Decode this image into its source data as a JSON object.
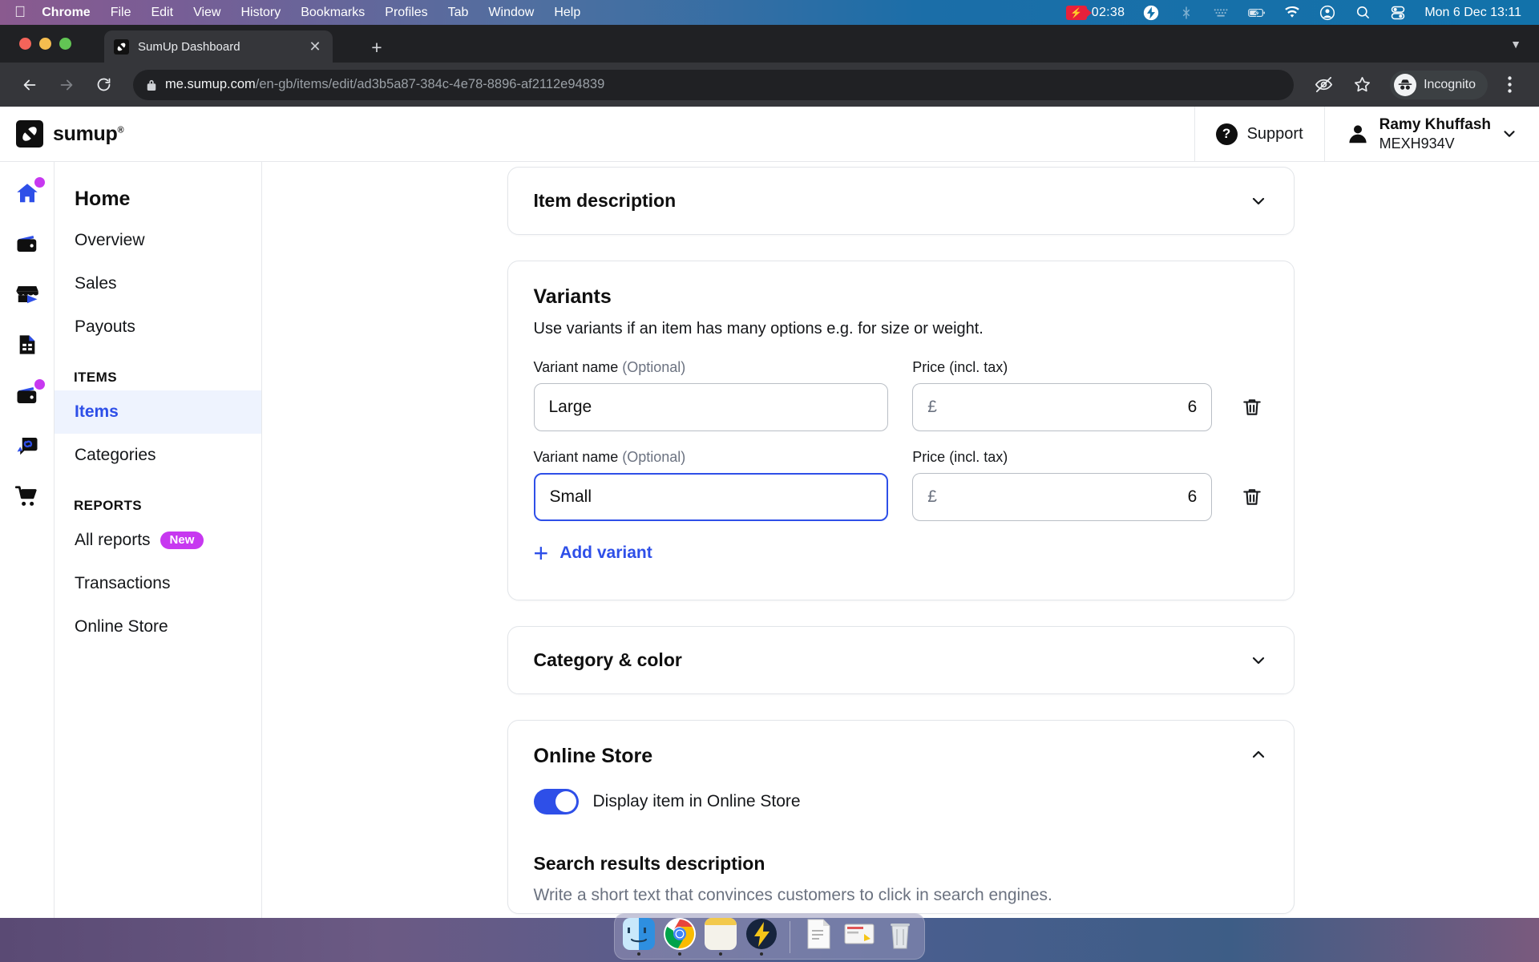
{
  "menubar": {
    "apple_icon": "apple-logo-icon",
    "items": [
      "Chrome",
      "File",
      "Edit",
      "View",
      "History",
      "Bookmarks",
      "Profiles",
      "Tab",
      "Window",
      "Help"
    ],
    "recording_time": "02:38",
    "status_icons": [
      "screen-recording-icon",
      "bolt-icon",
      "bluetooth-off-icon",
      "keyboard-brightness-icon",
      "battery-charging-icon",
      "wifi-icon",
      "user-account-icon",
      "spotlight-search-icon",
      "control-center-icon"
    ],
    "clock": "Mon 6 Dec  13:11"
  },
  "browser": {
    "tab": {
      "title": "SumUp Dashboard",
      "favicon": "sumup-logo-icon",
      "close_icon": "close-icon"
    },
    "new_tab_icon": "plus-icon",
    "tab_list_icon": "chevron-down-icon",
    "back_icon": "back-arrow-icon",
    "forward_icon": "forward-arrow-icon",
    "reload_icon": "reload-icon",
    "lock_icon": "lock-icon",
    "url_host": "me.sumup.com",
    "url_path": "/en-gb/items/edit/ad3b5a87-384c-4e78-8896-af2112e94839",
    "eye_off_icon": "eye-off-icon",
    "bookmark_icon": "star-icon",
    "profile_label": "Incognito",
    "profile_icon": "incognito-icon",
    "menu_icon": "three-dot-menu-icon"
  },
  "app_header": {
    "logo_text": "sumup",
    "logo_mark": "sumup-logo-icon",
    "support_label": "Support",
    "support_icon": "question-mark-icon",
    "account_name": "Ramy Khuffash",
    "account_id": "MEXH934V",
    "account_icon": "user-avatar-icon",
    "account_chevron": "chevron-down-icon"
  },
  "icon_rail": [
    {
      "name": "home-icon",
      "badge": true,
      "active": true
    },
    {
      "name": "wallet-icon",
      "badge": false,
      "active": false
    },
    {
      "name": "store-icon",
      "badge": false,
      "active": false
    },
    {
      "name": "invoice-icon",
      "badge": false,
      "active": false
    },
    {
      "name": "wallet-card-icon",
      "badge": true,
      "active": false
    },
    {
      "name": "payment-link-icon",
      "badge": false,
      "active": false
    },
    {
      "name": "shopping-cart-icon",
      "badge": false,
      "active": false
    }
  ],
  "sidebar": {
    "home_title": "Home",
    "home_links": [
      "Overview",
      "Sales",
      "Payouts"
    ],
    "items_section": "ITEMS",
    "items_links": [
      {
        "label": "Items",
        "active": true
      },
      {
        "label": "Categories",
        "active": false
      }
    ],
    "reports_section": "REPORTS",
    "reports_links": [
      {
        "label": "All reports",
        "badge": "New"
      },
      {
        "label": "Transactions",
        "badge": ""
      },
      {
        "label": "Online Store",
        "badge": ""
      }
    ]
  },
  "main": {
    "item_description": {
      "title": "Item description",
      "chevron": "chevron-down-icon"
    },
    "variants": {
      "title": "Variants",
      "subtitle": "Use variants if an item has many options e.g. for size or weight.",
      "name_label": "Variant name ",
      "name_label_optional": "(Optional)",
      "price_label": "Price (incl. tax)",
      "currency": "£",
      "rows": [
        {
          "name": "Large",
          "price": "6",
          "focused": false,
          "delete_icon": "trash-icon"
        },
        {
          "name": "Small",
          "price": "6",
          "focused": true,
          "delete_icon": "trash-icon"
        }
      ],
      "add_label": "Add variant",
      "add_icon": "plus-icon"
    },
    "category_color": {
      "title": "Category & color",
      "chevron": "chevron-down-icon"
    },
    "online_store": {
      "title": "Online Store",
      "chevron": "chevron-up-icon",
      "toggle_label": "Display item in Online Store",
      "toggle_on": true,
      "search_title": "Search results description",
      "search_sub": "Write a short text that convinces customers to click in search engines."
    }
  },
  "dock": {
    "items": [
      {
        "name": "finder-icon",
        "running": true
      },
      {
        "name": "chrome-icon",
        "running": true
      },
      {
        "name": "stickies-icon",
        "running": true
      },
      {
        "name": "lightning-app-icon",
        "running": true
      },
      {
        "name": "document-icon",
        "running": false
      },
      {
        "name": "screenshot-file-icon",
        "running": false
      },
      {
        "name": "trash-icon",
        "running": false
      }
    ]
  },
  "colors": {
    "accent_blue": "#2e4fe8",
    "badge_purple": "#c738f0",
    "record_red": "#e8213a",
    "active_nav_bg": "#eef3fe"
  }
}
